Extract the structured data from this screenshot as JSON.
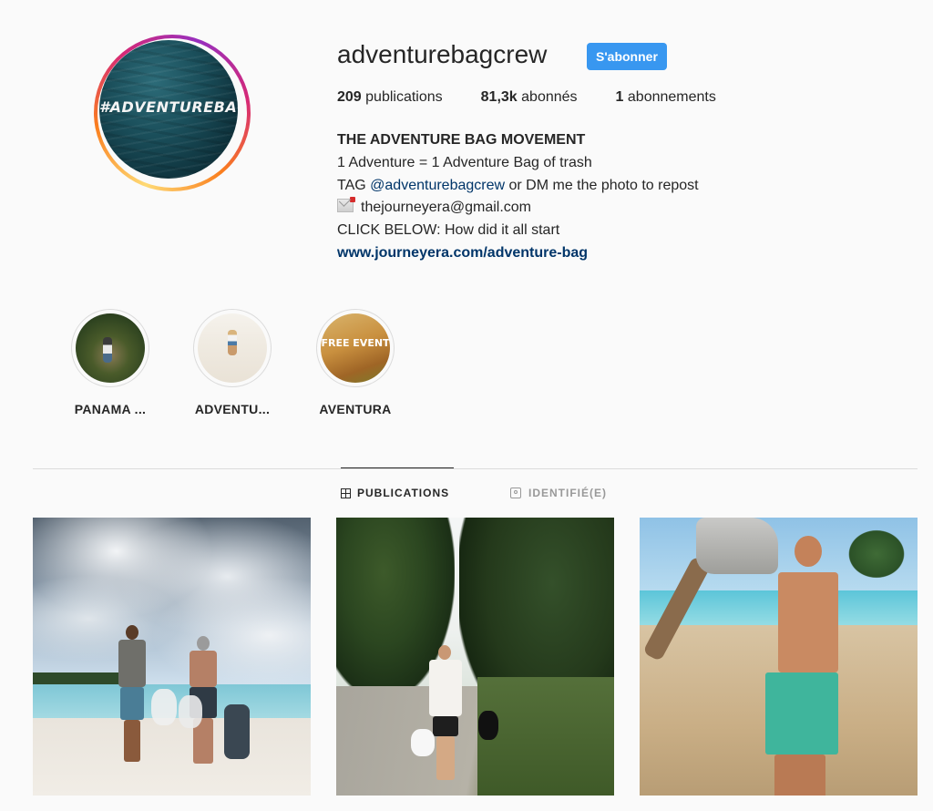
{
  "profile": {
    "username": "adventurebagcrew",
    "avatar_text": "#ADVENTUREBAG",
    "follow_label": "S'abonner",
    "stats": {
      "posts_count": "209",
      "posts_label": "publications",
      "followers_count": "81,3k",
      "followers_label": "abonnés",
      "following_count": "1",
      "following_label": "abonnements"
    },
    "bio": {
      "title": "THE ADVENTURE BAG MOVEMENT",
      "line1": "1 Adventure = 1 Adventure Bag of trash",
      "line2_prefix": "TAG ",
      "line2_mention": "@adventurebagcrew",
      "line2_suffix": " or DM me the photo to repost",
      "email": "thejourneyera@gmail.com",
      "line4": "CLICK BELOW: How did it all start",
      "link": "www.journeyera.com/adventure-bag"
    }
  },
  "highlights": [
    {
      "label": "PANAMA ...",
      "icon": "highlight-jungle-photo"
    },
    {
      "label": "ADVENTU...",
      "icon": "highlight-beach-photo"
    },
    {
      "label": "AVENTURA",
      "icon": "highlight-event-photo",
      "overlay_text": "FREE EVENT"
    }
  ],
  "tabs": {
    "publications": "PUBLICATIONS",
    "tagged": "IDENTIFIÉ(E)"
  },
  "posts": [
    {
      "icon": "beach-trash-couple-photo"
    },
    {
      "icon": "jungle-road-trash-photo"
    },
    {
      "icon": "beach-man-trash-bag-photo"
    }
  ],
  "colors": {
    "follow_button": "#3897f0",
    "link": "#003569",
    "background": "#fafafa"
  }
}
